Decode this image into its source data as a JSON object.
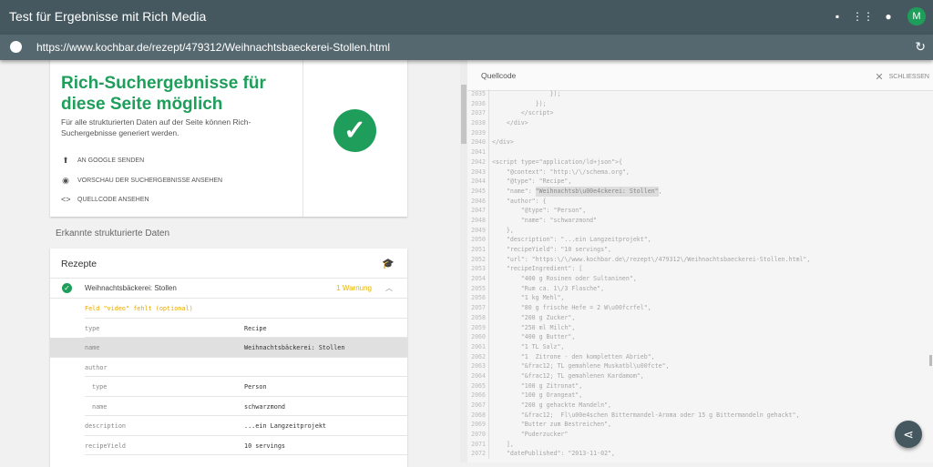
{
  "header": {
    "title": "Test für Ergebnisse mit Rich Media",
    "avatar_letter": "M",
    "icons": [
      "feedback-icon",
      "apps-icon",
      "account-icon"
    ]
  },
  "urlbar": {
    "url": "https://www.kochbar.de/rezept/479312/Weihnachtsbaeckerei-Stollen.html"
  },
  "result": {
    "title": "Rich-Suchergebnisse für diese Seite möglich",
    "description": "Für alle strukturierten Daten auf der Seite können Rich-Suchergebnisse generiert werden.",
    "actions": [
      "AN GOOGLE SENDEN",
      "VORSCHAU DER SUCHERGEBNISSE ANSEHEN",
      "QUELLCODE ANSEHEN"
    ]
  },
  "detected": {
    "section_title": "Erkannte strukturierte Daten",
    "card_title": "Rezepte",
    "item_name": "Weihnachtsbäckerei: Stollen",
    "warning_count": "1 Warnung",
    "warning_text": "Feld \"video\" fehlt (optional)",
    "rows": [
      {
        "k": "type",
        "v": "Recipe"
      },
      {
        "k": "name",
        "v": "Weihnachtsbäckerei: Stollen"
      },
      {
        "k": "author",
        "v": ""
      },
      {
        "k": "type",
        "v": "Person"
      },
      {
        "k": "name",
        "v": "schwarzmond"
      },
      {
        "k": "description",
        "v": "...ein Langzeitprojekt"
      },
      {
        "k": "recipeYield",
        "v": "10 servings"
      }
    ]
  },
  "source": {
    "title": "Quellcode",
    "close_label": "SCHLIESSEN",
    "lines": [
      {
        "n": "2035",
        "t": "                });"
      },
      {
        "n": "2036",
        "t": "            });"
      },
      {
        "n": "2037",
        "t": "        </script>"
      },
      {
        "n": "2038",
        "t": "    </div>"
      },
      {
        "n": "2039",
        "t": ""
      },
      {
        "n": "2040",
        "t": "</div>"
      },
      {
        "n": "2041",
        "t": ""
      },
      {
        "n": "2042",
        "t": "<script type=\"application/ld+json\">{"
      },
      {
        "n": "2043",
        "t": "    \"@context\": \"http:\\/\\/schema.org\","
      },
      {
        "n": "2044",
        "t": "    \"@type\": \"Recipe\","
      },
      {
        "n": "2045",
        "t": "    \"name\": ",
        "h": "\"Weihnachtsb\\u00e4ckerei: Stollen\"",
        "p": ","
      },
      {
        "n": "2046",
        "t": "    \"author\": {"
      },
      {
        "n": "2047",
        "t": "        \"@type\": \"Person\","
      },
      {
        "n": "2048",
        "t": "        \"name\": \"schwarzmond\""
      },
      {
        "n": "2049",
        "t": "    },"
      },
      {
        "n": "2050",
        "t": "    \"description\": \"...ein Langzeitprojekt\","
      },
      {
        "n": "2051",
        "t": "    \"recipeYield\": \"10 servings\","
      },
      {
        "n": "2052",
        "t": "    \"url\": \"https:\\/\\/www.kochbar.de\\/rezept\\/479312\\/Weihnachtsbaeckerei-Stollen.html\","
      },
      {
        "n": "2053",
        "t": "    \"recipeIngredient\": ["
      },
      {
        "n": "2054",
        "t": "        \"400 g Rosinen oder Sultaninen\","
      },
      {
        "n": "2055",
        "t": "        \"Rum ca. 1\\/3 Flasche\","
      },
      {
        "n": "2056",
        "t": "        \"1 kg Mehl\","
      },
      {
        "n": "2057",
        "t": "        \"80 g frische Hefe = 2 W\\u00fcrfel\","
      },
      {
        "n": "2058",
        "t": "        \"200 g Zucker\","
      },
      {
        "n": "2059",
        "t": "        \"250 ml Milch\","
      },
      {
        "n": "2060",
        "t": "        \"400 g Butter\","
      },
      {
        "n": "2061",
        "t": "        \"1 TL Salz\","
      },
      {
        "n": "2062",
        "t": "        \"1  Zitrone - den kompletten Abrieb\","
      },
      {
        "n": "2063",
        "t": "        \"&frac12; TL gemahlene Muskatbl\\u00fcte\","
      },
      {
        "n": "2064",
        "t": "        \"&frac12; TL gemahlenen Kardamom\","
      },
      {
        "n": "2065",
        "t": "        \"100 g Zitronat\","
      },
      {
        "n": "2066",
        "t": "        \"100 g Orangeat\","
      },
      {
        "n": "2067",
        "t": "        \"200 g gehackte Mandeln\","
      },
      {
        "n": "2068",
        "t": "        \"&frac12;  Fl\\u00e4schen Bittermandel-Aroma oder 15 g Bittermandeln gehackt\","
      },
      {
        "n": "2069",
        "t": "        \"Butter zum Bestreichen\","
      },
      {
        "n": "2070",
        "t": "        \"Puderzucker\""
      },
      {
        "n": "2071",
        "t": "    ],"
      },
      {
        "n": "2072",
        "t": "    \"datePublished\": \"2013-11-02\","
      }
    ]
  }
}
